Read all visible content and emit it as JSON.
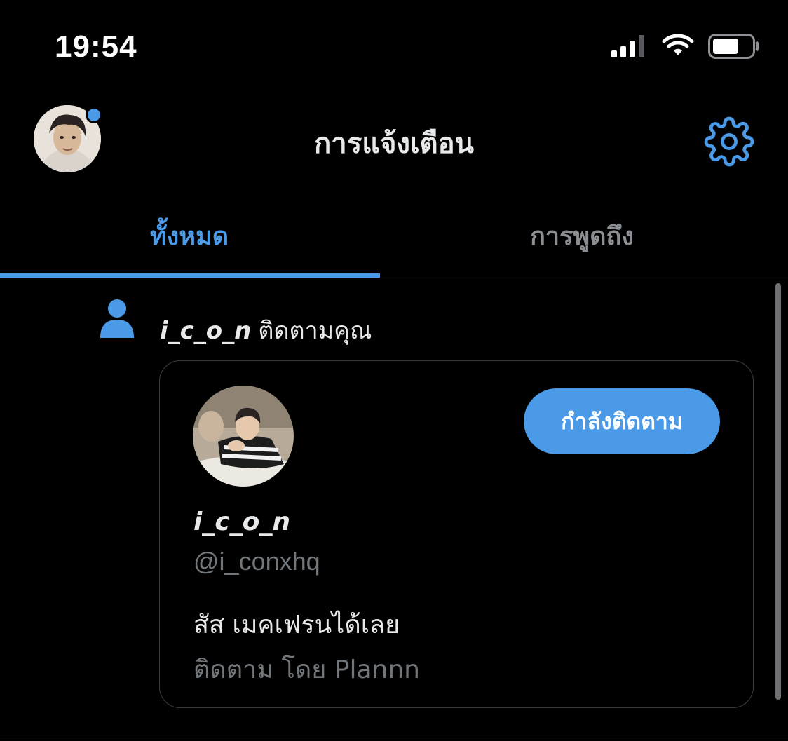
{
  "status_bar": {
    "time": "19:54",
    "icons": [
      "signal-icon",
      "wifi-icon",
      "battery-icon"
    ]
  },
  "header": {
    "title": "การแจ้งเตือน",
    "settings_icon": "gear-icon"
  },
  "tabs": [
    {
      "label": "ทั้งหมด",
      "active": true
    },
    {
      "label": "การพูดถึง",
      "active": false
    }
  ],
  "notification": {
    "icon": "person-icon",
    "username": "i_c_o_n",
    "action": "ติดตามคุณ",
    "card": {
      "display_name": "i_c_o_n",
      "handle": "@i_conxhq",
      "follow_button": "กำลังติดตาม",
      "bio": "สัส เมคเฟรนได้เลย",
      "followed_by": "ติดตาม โดย Plannn"
    }
  },
  "colors": {
    "accent": "#4a9ae8",
    "background": "#000000",
    "muted_text": "#71767b"
  }
}
